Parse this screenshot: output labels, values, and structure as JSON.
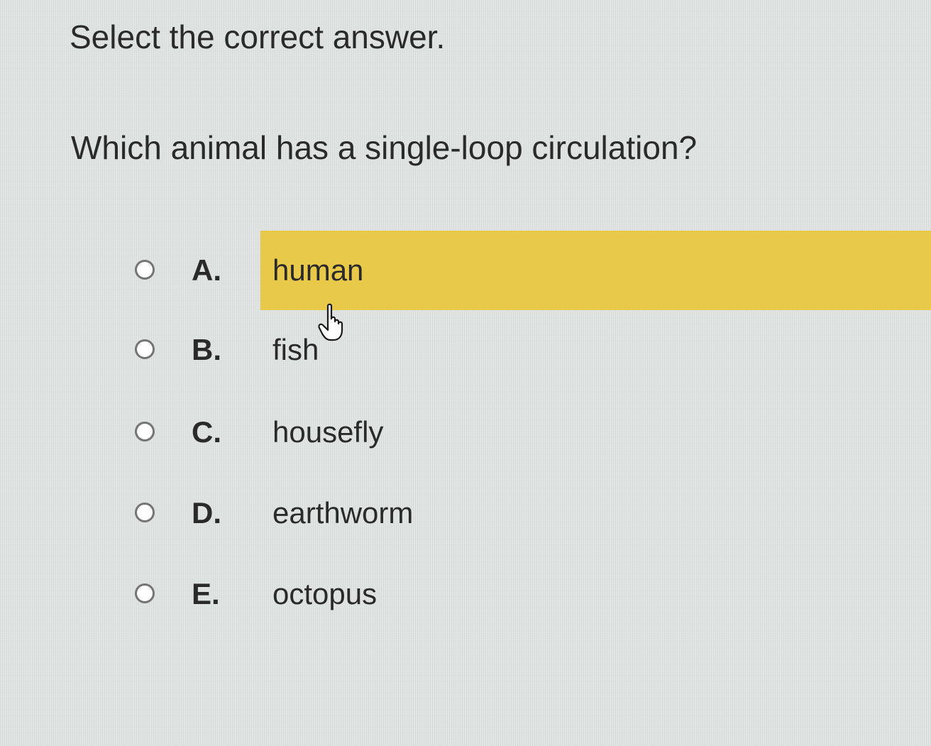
{
  "instruction": "Select the correct answer.",
  "question": "Which animal has a single-loop circulation?",
  "options": [
    {
      "letter": "A.",
      "text": "human",
      "highlighted": true
    },
    {
      "letter": "B.",
      "text": "fish",
      "highlighted": false
    },
    {
      "letter": "C.",
      "text": "housefly",
      "highlighted": false
    },
    {
      "letter": "D.",
      "text": "earthworm",
      "highlighted": false
    },
    {
      "letter": "E.",
      "text": "octopus",
      "highlighted": false
    }
  ],
  "colors": {
    "highlight": "#e9c94a",
    "text": "#2a2a2a",
    "background": "#dfe3e1"
  },
  "cursor_icon": "hand-pointer-icon"
}
